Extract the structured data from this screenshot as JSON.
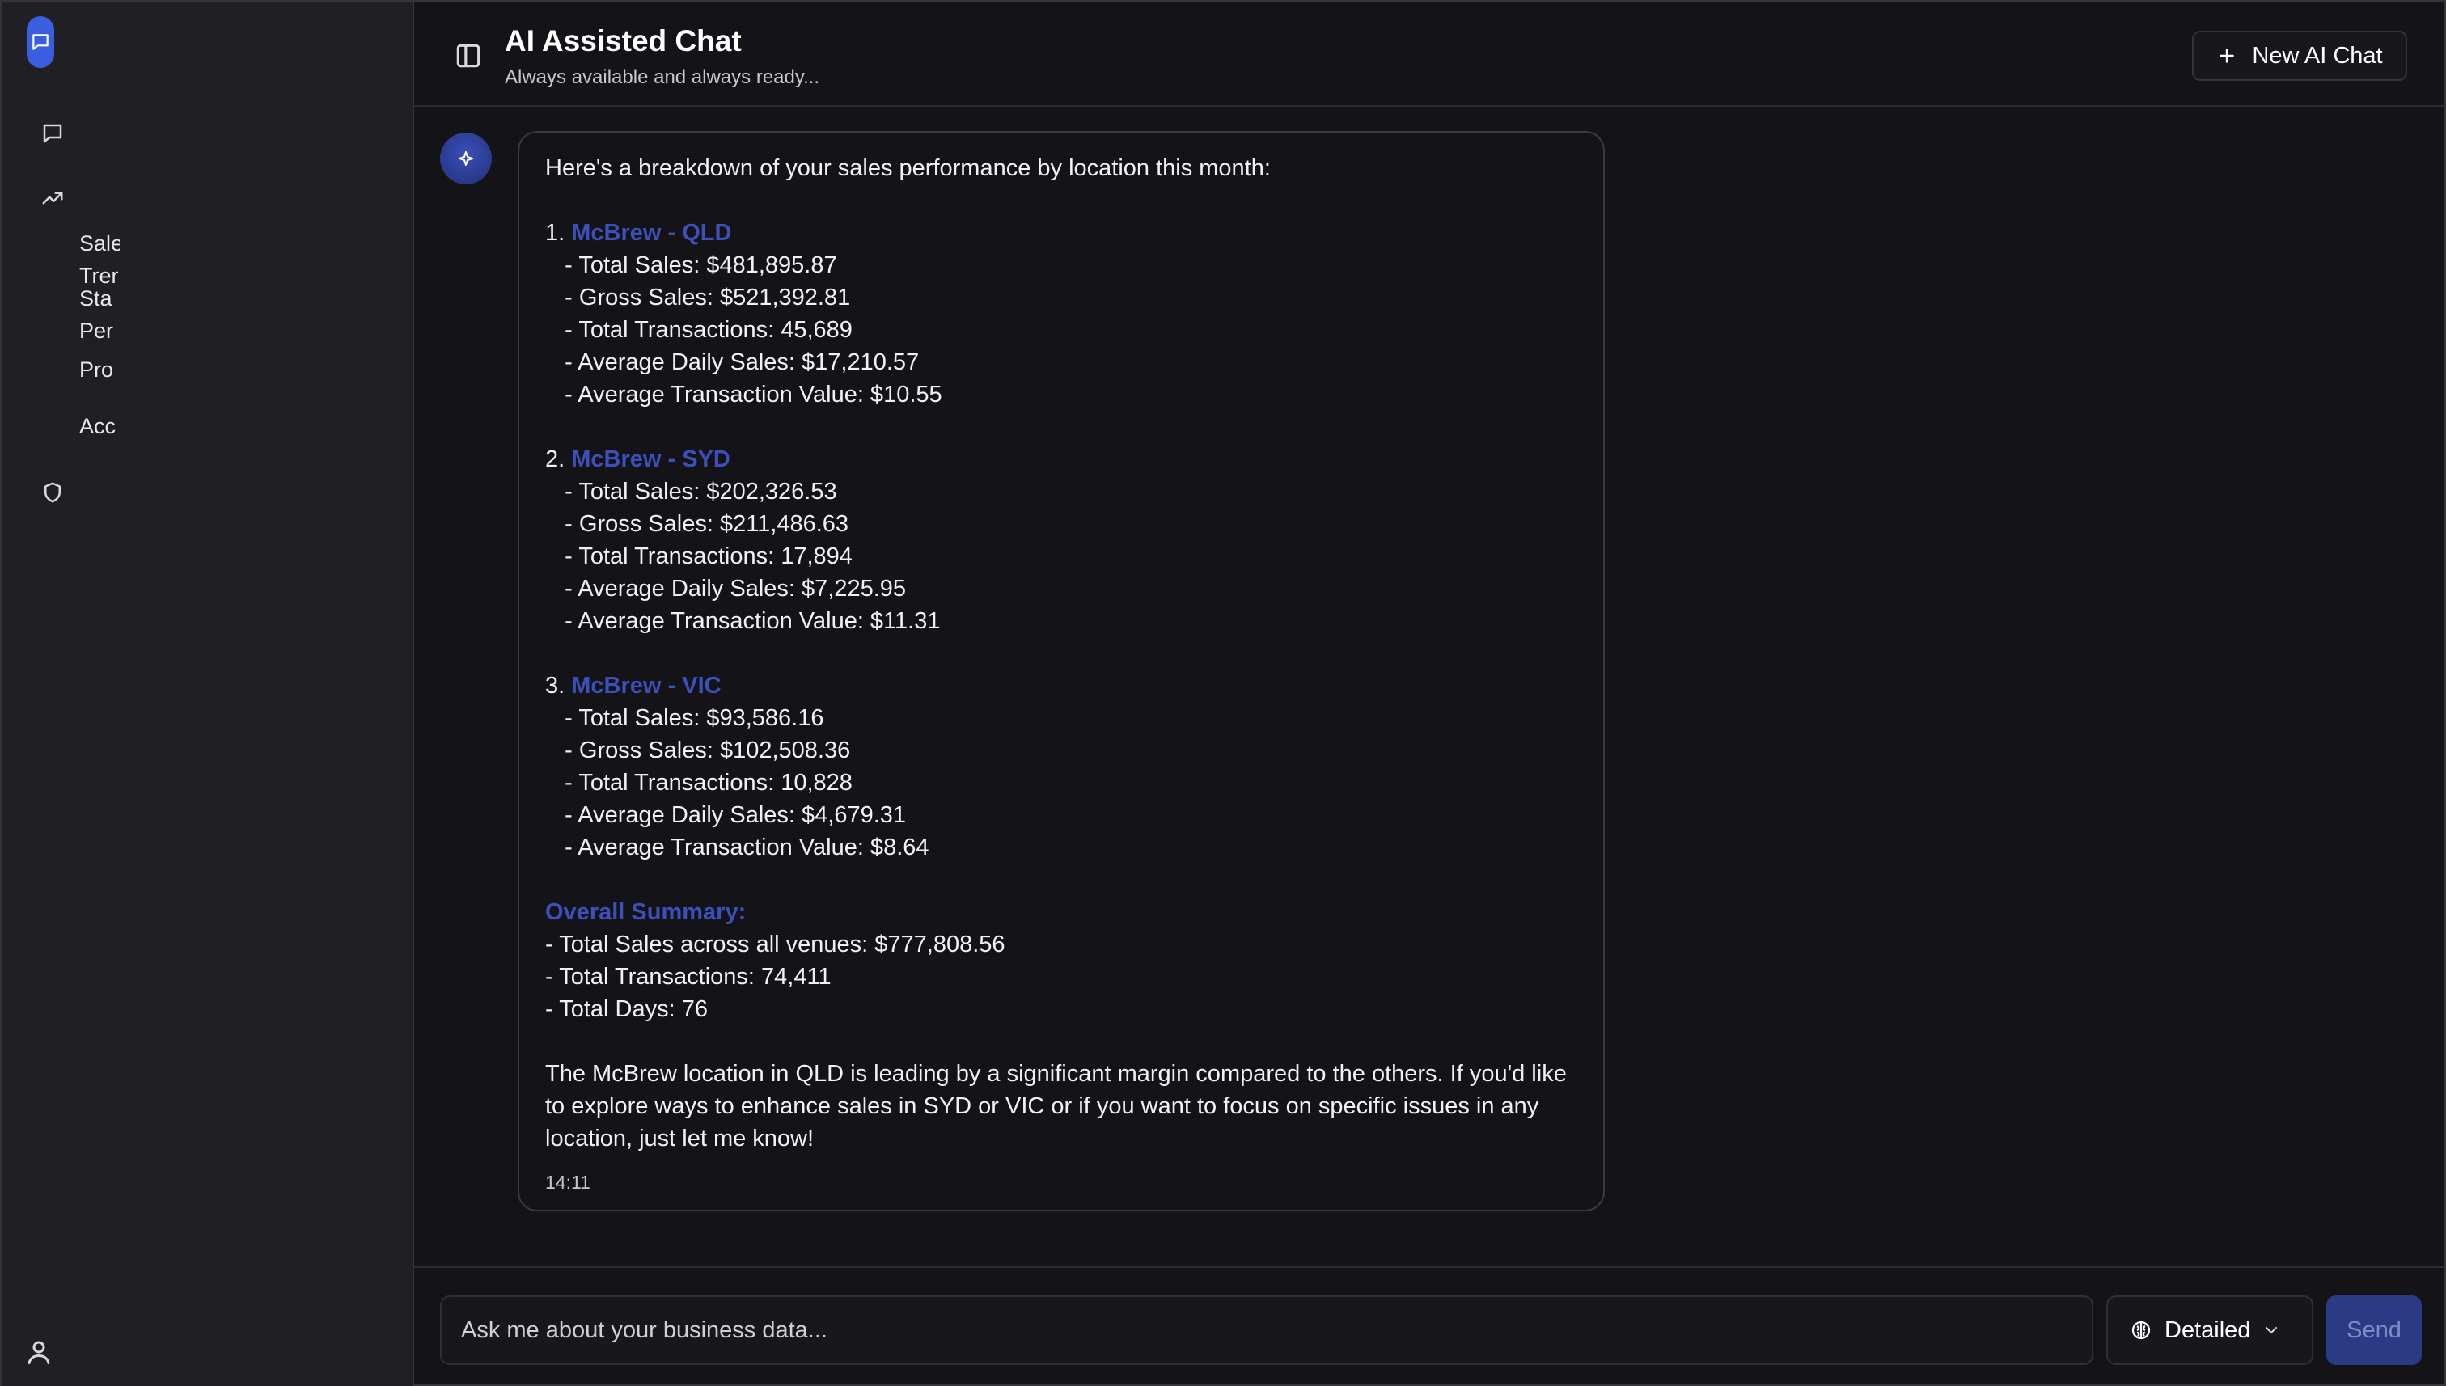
{
  "header": {
    "title": "AI Assisted Chat",
    "subtitle": "Always available and always ready...",
    "new_chat_label": "New AI Chat"
  },
  "sidebar": {
    "sub_items": [
      "Sale",
      "Trer",
      "Sta",
      "Per",
      "Pro",
      "Acc"
    ]
  },
  "message": {
    "intro": "Here's a breakdown of your sales performance by location this month:",
    "locations": [
      {
        "number": "1.",
        "name": "McBrew - QLD",
        "lines": [
          "   - Total Sales: $481,895.87",
          "   - Gross Sales: $521,392.81",
          "   - Total Transactions: 45,689",
          "   - Average Daily Sales: $17,210.57",
          "   - Average Transaction Value: $10.55"
        ]
      },
      {
        "number": "2.",
        "name": "McBrew - SYD",
        "lines": [
          "   - Total Sales: $202,326.53",
          "   - Gross Sales: $211,486.63",
          "   - Total Transactions: 17,894",
          "   - Average Daily Sales: $7,225.95",
          "   - Average Transaction Value: $11.31"
        ]
      },
      {
        "number": "3.",
        "name": "McBrew - VIC",
        "lines": [
          "   - Total Sales: $93,586.16",
          "   - Gross Sales: $102,508.36",
          "   - Total Transactions: 10,828",
          "   - Average Daily Sales: $4,679.31",
          "   - Average Transaction Value: $8.64"
        ]
      }
    ],
    "summary_heading": "Overall Summary:",
    "summary_lines": [
      "- Total Sales across all venues: $777,808.56",
      "- Total Transactions: 74,411",
      "- Total Days: 76"
    ],
    "closing": "The McBrew location in QLD is leading by a significant margin compared to the others. If you'd like to explore ways to enhance sales in SYD or VIC or if you want to focus on specific issues in any location, just let me know!",
    "time": "14:11"
  },
  "composer": {
    "placeholder": "Ask me about your business data...",
    "mode": "Detailed",
    "send_label": "Send"
  },
  "colors": {
    "accent": "#3d4fb8",
    "brand": "#3b5ee0",
    "background": "#131318",
    "sidebar": "#202024"
  },
  "icons": {
    "logo": "chat-bubble-icon",
    "nav_chat": "message-square-icon",
    "nav_trends": "trending-up-icon",
    "nav_security": "shield-icon",
    "user": "user-icon",
    "panel": "sidebar-panel-icon",
    "plus": "plus-icon",
    "ai": "sparkle-icon",
    "mode": "brain-icon",
    "chevron": "chevron-down-icon"
  }
}
